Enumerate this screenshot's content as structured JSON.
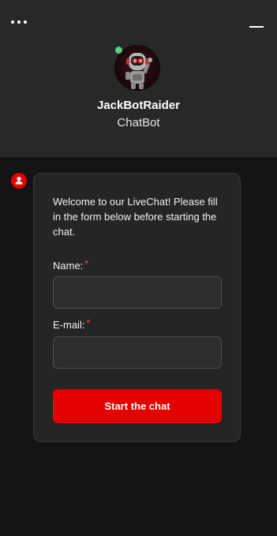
{
  "header": {
    "bot_name": "JackBotRaider",
    "bot_role": "ChatBot",
    "status_color": "#5fd07a"
  },
  "icons": {
    "menu": "more-dots-icon",
    "minimize": "minimize-icon",
    "agent": "user-icon"
  },
  "form": {
    "welcome_text": "Welcome to our LiveChat! Please fill in the form below before starting the chat.",
    "name_label": "Name:",
    "name_required": "*",
    "name_value": "",
    "email_label": "E-mail:",
    "email_required": "*",
    "email_value": "",
    "submit_label": "Start the chat"
  },
  "colors": {
    "accent": "#e40000",
    "header_bg": "#282828",
    "body_bg": "#141414",
    "card_bg": "#252525"
  }
}
